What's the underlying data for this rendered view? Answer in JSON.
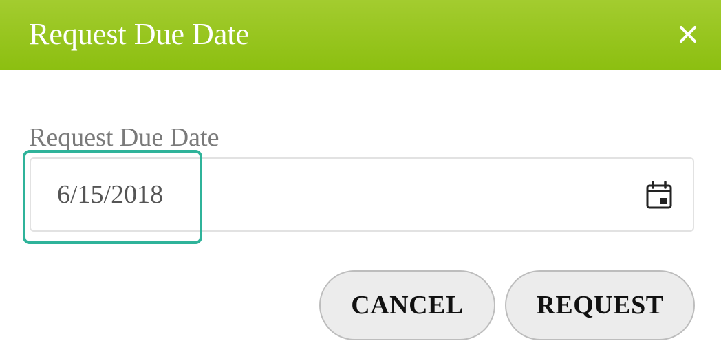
{
  "dialog": {
    "title": "Request Due Date",
    "close_icon": "close-icon"
  },
  "form": {
    "due_date_label": "Request Due Date",
    "due_date_value": "6/15/2018",
    "calendar_icon": "calendar-icon"
  },
  "actions": {
    "cancel_label": "CANCEL",
    "request_label": "REQUEST"
  },
  "colors": {
    "header_bg": "#8cbf10",
    "focus_outline": "#2fb39a",
    "button_bg": "#ececec"
  }
}
